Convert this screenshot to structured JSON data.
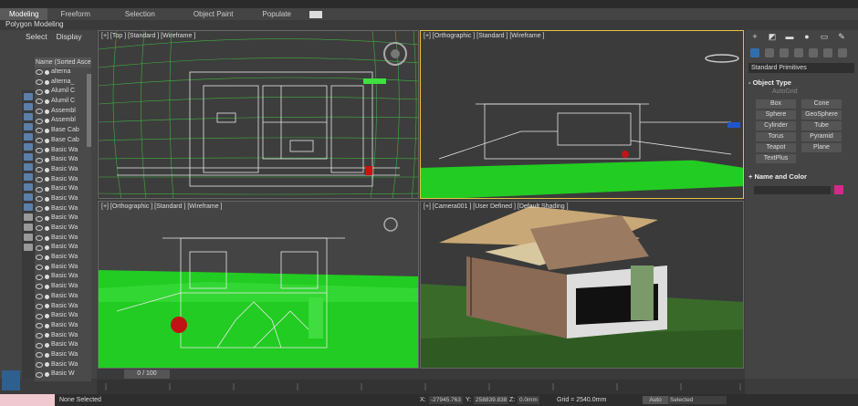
{
  "ribbon": {
    "tabs": [
      {
        "label": "Modeling"
      },
      {
        "label": "Freeform"
      },
      {
        "label": "Selection"
      },
      {
        "label": "Object Paint"
      },
      {
        "label": "Populate"
      }
    ],
    "panel_label": "Polygon Modeling"
  },
  "explorer": {
    "tabs": [
      "Select",
      "Display"
    ],
    "header": "Name (Sorted Ascending)",
    "items": [
      "alterna",
      "alterna_",
      "Alumil C",
      "Alumil C",
      "Assembl",
      "Assembl",
      "Base Cab",
      "Base Cab",
      "Basic Wa",
      "Basic Wa",
      "Basic Wa",
      "Basic Wa",
      "Basic Wa",
      "Basic Wa",
      "Basic Wa",
      "Basic Wa",
      "Basic Wa",
      "Basic Wa",
      "Basic Wa",
      "Basic Wa",
      "Basic Wa",
      "Basic Wa",
      "Basic Wa",
      "Basic Wa",
      "Basic Wa",
      "Basic Wa",
      "Basic Wa",
      "Basic Wa",
      "Basic Wa",
      "Basic Wa",
      "Basic Wa",
      "Basic W"
    ]
  },
  "viewports": {
    "top": "[+] [Top ] [Standard ] [Wireframe ]",
    "ortho1": "[+] [Orthographic ] [Standard ] [Wireframe ]",
    "ortho2": "[+] [Orthographic ] [Standard ] [Wireframe ]",
    "camera": "[+] [Camera001 ] [User Defined ] [Default Shading ]"
  },
  "command_panel": {
    "dropdown": "Standard Primitives",
    "object_type_title": "Object Type",
    "autogrid": "AutoGrid",
    "buttons": [
      "Box",
      "Cone",
      "Sphere",
      "GeoSphere",
      "Cylinder",
      "Tube",
      "Torus",
      "Pyramid",
      "Teapot",
      "Plane",
      "TextPlus"
    ],
    "name_color_title": "Name and Color",
    "swatch_color": "#d8268b"
  },
  "timeline": {
    "frame": "0 / 100"
  },
  "status": {
    "selection": "None Selected",
    "x_value": "-27945.763",
    "y_value": "258839.838",
    "z_value": "0.0mm",
    "grid": "Grid = 2540.0mm",
    "auto": "Auto",
    "selected": "Selected"
  }
}
